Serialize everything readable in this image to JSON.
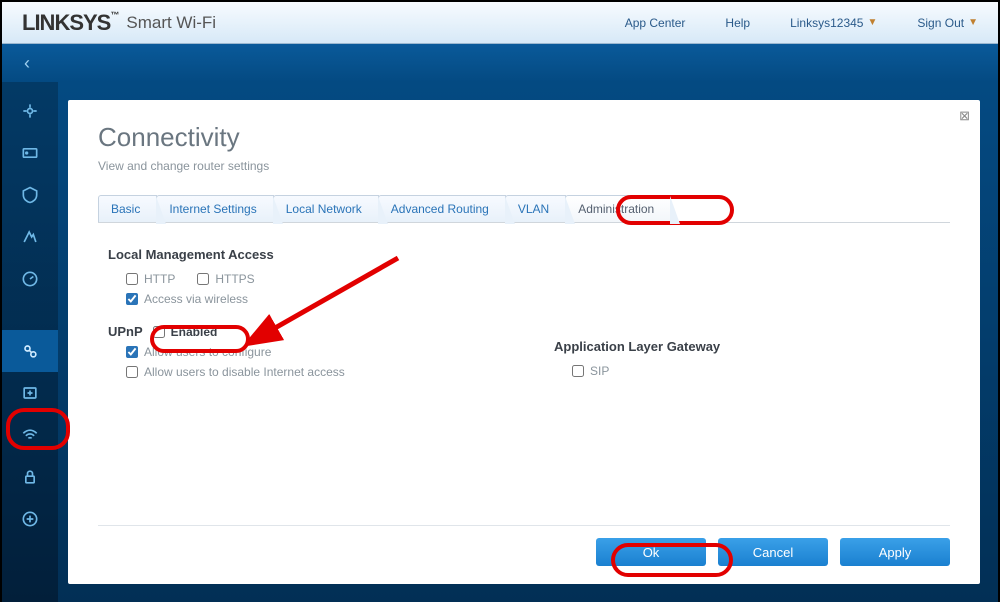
{
  "top": {
    "brand": "LINKSYS",
    "brand_sub": "Smart Wi-Fi",
    "links": {
      "appcenter": "App Center",
      "help": "Help",
      "device": "Linksys12345",
      "signout": "Sign Out"
    }
  },
  "page": {
    "title": "Connectivity",
    "subtitle": "View and change router settings"
  },
  "tabs": [
    "Basic",
    "Internet Settings",
    "Local Network",
    "Advanced Routing",
    "VLAN",
    "Administration"
  ],
  "active_tab": 5,
  "local_mgmt": {
    "heading": "Local Management Access",
    "http": "HTTP",
    "https": "HTTPS",
    "wireless": "Access via wireless",
    "http_checked": false,
    "https_checked": false,
    "wireless_checked": true
  },
  "upnp": {
    "heading": "UPnP",
    "enabled_label": "Enabled",
    "enabled_checked": false,
    "allow_config": "Allow users to configure",
    "allow_config_checked": true,
    "allow_disable": "Allow users to disable Internet access",
    "allow_disable_checked": false
  },
  "alg": {
    "heading": "Application Layer Gateway",
    "sip": "SIP",
    "sip_checked": false
  },
  "buttons": {
    "ok": "Ok",
    "cancel": "Cancel",
    "apply": "Apply"
  }
}
